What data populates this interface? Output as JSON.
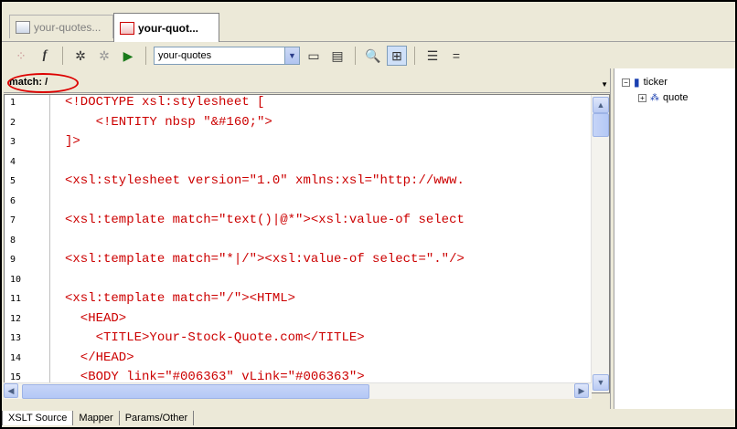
{
  "tabs": [
    {
      "label": "your-quotes...",
      "active": false
    },
    {
      "label": "your-quot...",
      "active": true
    }
  ],
  "toolbar": {
    "select_value": "your-quotes",
    "icons": [
      "pointer-icon",
      "function-icon",
      "xpath-icon",
      "no-xpath-icon",
      "run-icon",
      "browse-icon",
      "output-icon",
      "find-icon",
      "tree-icon",
      "indent-icon",
      "equals-icon"
    ]
  },
  "match": {
    "label": "match: /"
  },
  "editor": {
    "line_numbers": [
      "1",
      "2",
      "3",
      "4",
      "5",
      "6",
      "7",
      "8",
      "9",
      "10",
      "11",
      "12",
      "13",
      "14",
      "15"
    ],
    "lines": [
      "<!DOCTYPE xsl:stylesheet [",
      "    <!ENTITY nbsp \"&#160;\">",
      "]>",
      "",
      "<xsl:stylesheet version=\"1.0\" xmlns:xsl=\"http://www.",
      "",
      "<xsl:template match=\"text()|@*\"><xsl:value-of select",
      "",
      "<xsl:template match=\"*|/\"><xsl:value-of select=\".\"/>",
      "",
      "<xsl:template match=\"/\"><HTML>",
      "  <HEAD>",
      "    <TITLE>Your-Stock-Quote.com</TITLE>",
      "  </HEAD>",
      "  <BODY link=\"#006363\" vLink=\"#006363\">"
    ]
  },
  "tree": {
    "root": "ticker",
    "child": "quote"
  },
  "bottom_tabs": [
    "XSLT Source",
    "Mapper",
    "Params/Other"
  ]
}
